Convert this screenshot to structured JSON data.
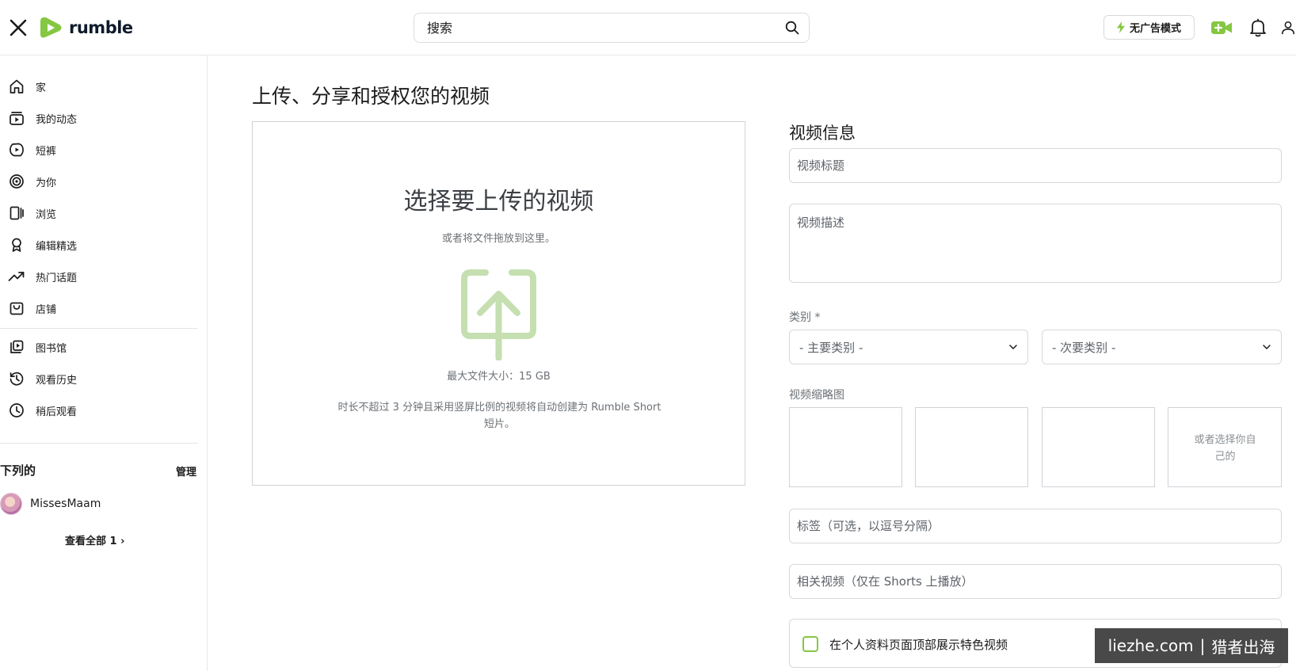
{
  "header": {
    "logo_text": "rumble",
    "search_placeholder": "搜索",
    "noads_label": "无广告模式"
  },
  "sidebar": {
    "items": [
      {
        "label": "家",
        "icon": "home-icon"
      },
      {
        "label": "我的动态",
        "icon": "subscriptions-icon"
      },
      {
        "label": "短裤",
        "icon": "shorts-icon"
      },
      {
        "label": "为你",
        "icon": "for-you-icon"
      },
      {
        "label": "浏览",
        "icon": "browse-icon"
      },
      {
        "label": "编辑精选",
        "icon": "editor-picks-icon"
      },
      {
        "label": "热门话题",
        "icon": "trending-icon"
      },
      {
        "label": "店铺",
        "icon": "shop-icon"
      },
      {
        "label": "图书馆",
        "icon": "library-icon"
      },
      {
        "label": "观看历史",
        "icon": "history-icon"
      },
      {
        "label": "稍后观看",
        "icon": "watch-later-icon"
      }
    ],
    "following_title": "下列的",
    "manage_label": "管理",
    "subscription_name": "MissesMaam",
    "see_all_label": "查看全部 1 ›"
  },
  "main": {
    "page_title": "上传、分享和授权您的视频",
    "upload": {
      "heading": "选择要上传的视频",
      "drag_hint": "或者将文件拖放到这里。",
      "max_size": "最大文件大小：15 GB",
      "shorts_note": "时长不超过 3 分钟且采用竖屏比例的视频将自动创建为 Rumble Short 短片。"
    },
    "info": {
      "section_title": "视频信息",
      "title_placeholder": "视频标题",
      "description_placeholder": "视频描述",
      "category_label": "类别 *",
      "primary_category": "- 主要类别 -",
      "secondary_category": "- 次要类别 -",
      "thumbnail_label": "视频缩略图",
      "custom_thumb": "或者选择你自己的",
      "tags_placeholder": "标签（可选，以逗号分隔）",
      "related_placeholder": "相关视频（仅在 Shorts 上播放）",
      "feature_label": "在个人资料页面顶部展示特色视频"
    }
  },
  "watermark": {
    "site": "liezhe.com",
    "separator": "|",
    "name": "猎者出海"
  },
  "colors": {
    "brand_green": "#85c742",
    "upload_icon_green": "#c5dfb0"
  }
}
